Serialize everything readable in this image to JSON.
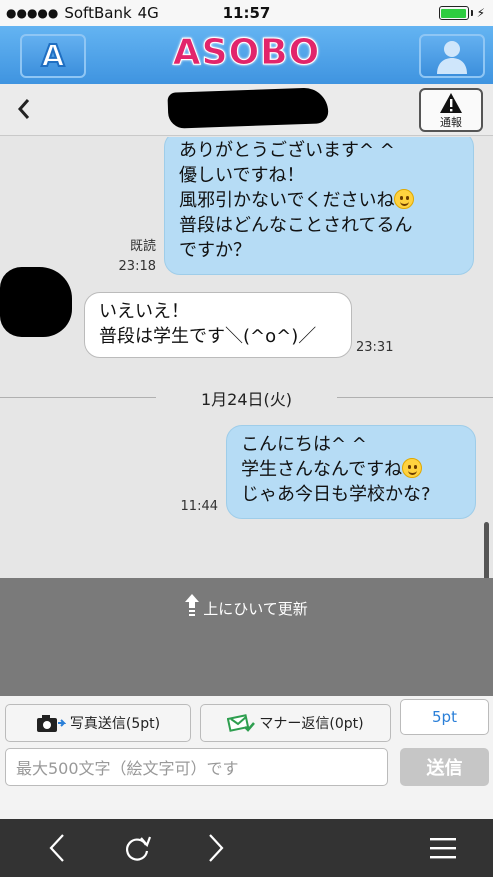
{
  "status": {
    "signal": "●●●●●",
    "carrier": "SoftBank",
    "network": "4G",
    "time": "11:57"
  },
  "app": {
    "logo": "ASOBO",
    "left_button": "A"
  },
  "chat": {
    "report_label": "通報"
  },
  "messages": [
    {
      "side": "me",
      "lines": [
        "ありがとうございます^ ^",
        "優しいですね！",
        "風邪引かないでくださいね",
        "普段はどんなことされてるん",
        "ですか？"
      ],
      "read": "既読",
      "time": "23:18"
    },
    {
      "side": "them",
      "lines": [
        "いえいえ！",
        "普段は学生です＼(^o^)／"
      ],
      "time": "23:31"
    },
    {
      "side": "me",
      "lines": [
        "こんにちは^ ^",
        "学生さんなんですね",
        "じゃあ今日も学校かな?"
      ],
      "time": "11:44"
    }
  ],
  "date_divider": "1月24日(火)",
  "pull_refresh": "上にひいて更新",
  "input": {
    "photo_button": "写真送信(5pt)",
    "manner_button": "マナー返信(0pt)",
    "points": "5pt",
    "placeholder": "最大500文字（絵文字可）です",
    "send": "送信"
  },
  "colors": {
    "header": "#3f94e0",
    "logo": "#e2256b",
    "my_bubble": "#b6dcf5",
    "points_text": "#2a7fd8"
  }
}
